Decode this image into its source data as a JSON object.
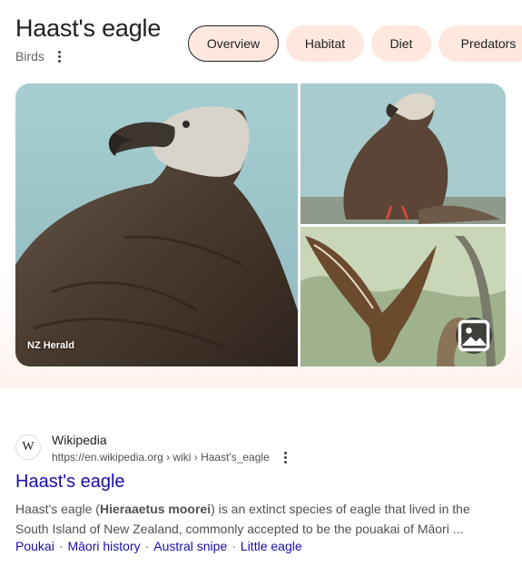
{
  "knowledge_panel": {
    "title": "Haast's eagle",
    "subtitle": "Birds",
    "chips": [
      {
        "label": "Overview",
        "active": true
      },
      {
        "label": "Habitat",
        "active": false
      },
      {
        "label": "Diet",
        "active": false
      },
      {
        "label": "Predators",
        "active": false
      }
    ],
    "images": {
      "main_source": "NZ Herald"
    },
    "colors": {
      "chip_bg": "#fde7de",
      "panel_fade": "#fdf3ef"
    }
  },
  "result": {
    "favicon_letter": "W",
    "site_name": "Wikipedia",
    "url": "https://en.wikipedia.org › wiki › Haast's_eagle",
    "title": "Haast's eagle",
    "snippet_pre": "Haast's eagle (",
    "snippet_bold": "Hieraaetus moorei",
    "snippet_line1_post": ") is an extinct species of eagle that lived in the",
    "snippet_line2": "South Island of New Zealand, commonly accepted to be the pouakai of Māori ...",
    "sitelinks": [
      "Poukai",
      "Māori history",
      "Austral snipe",
      "Little eagle"
    ],
    "colors": {
      "link": "#1a0dab",
      "text": "#4d5156"
    }
  }
}
